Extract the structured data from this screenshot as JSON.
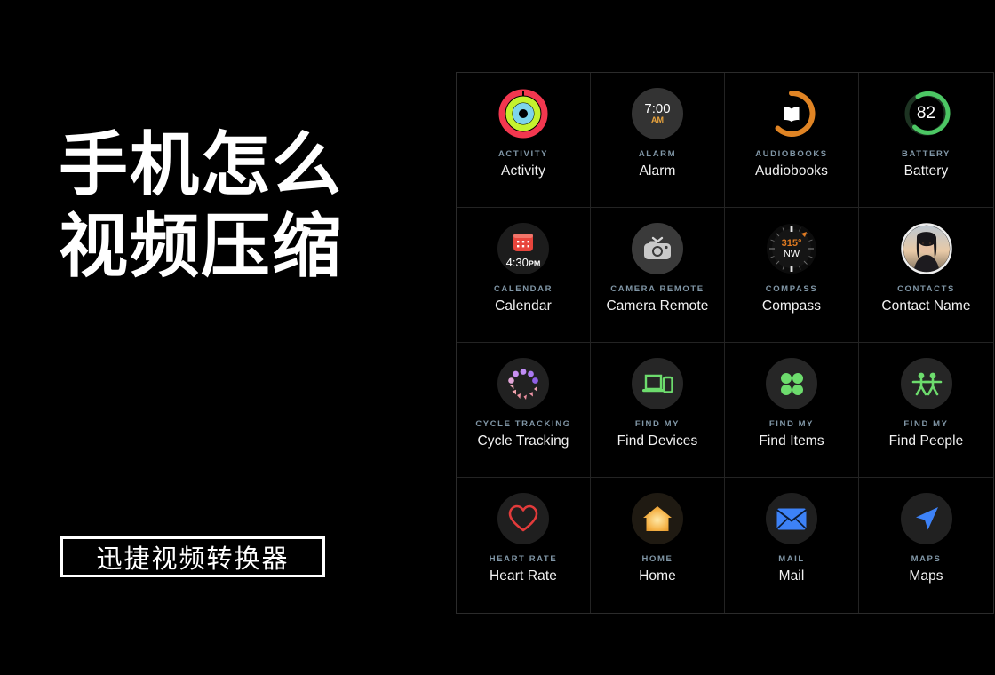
{
  "promo": {
    "title": "手机怎么\n视频压缩",
    "cta_label": "迅捷视频转换器",
    "colors": {
      "text": "#ffffff",
      "background": "#000000"
    }
  },
  "grid": {
    "columns": 4,
    "rows": 4,
    "colors": {
      "background": "#000000",
      "divider": "#232323",
      "category_label": "#8096a6",
      "app_name": "#f2f2f2"
    },
    "apps": [
      {
        "category": "ACTIVITY",
        "name": "Activity",
        "icon": "activity-rings-icon",
        "accent": "#f2374f"
      },
      {
        "category": "ALARM",
        "name": "Alarm",
        "icon": "alarm-clock-icon",
        "accent": "#e8a33d",
        "time": "7:00",
        "meridiem": "AM"
      },
      {
        "category": "AUDIOBOOKS",
        "name": "Audiobooks",
        "icon": "audiobooks-icon",
        "accent": "#e08424"
      },
      {
        "category": "BATTERY",
        "name": "Battery",
        "icon": "battery-ring-icon",
        "accent": "#4cc764",
        "value": "82"
      },
      {
        "category": "CALENDAR",
        "name": "Calendar",
        "icon": "calendar-icon",
        "accent": "#f04242",
        "time": "4:30",
        "meridiem": "PM"
      },
      {
        "category": "CAMERA REMOTE",
        "name": "Camera Remote",
        "icon": "camera-icon",
        "accent": "#b8b8b8"
      },
      {
        "category": "COMPASS",
        "name": "Compass",
        "icon": "compass-icon",
        "accent": "#e07a20",
        "heading": "315°",
        "direction": "NW"
      },
      {
        "category": "CONTACTS",
        "name": "Contact Name",
        "icon": "contact-avatar-icon",
        "accent": "#e6e6e6"
      },
      {
        "category": "CYCLE TRACKING",
        "name": "Cycle Tracking",
        "icon": "cycle-tracking-icon",
        "accent": "#9b6ef0"
      },
      {
        "category": "FIND MY",
        "name": "Find Devices",
        "icon": "find-devices-icon",
        "accent": "#6ddc6d"
      },
      {
        "category": "FIND MY",
        "name": "Find Items",
        "icon": "find-items-icon",
        "accent": "#6ddc6d"
      },
      {
        "category": "FIND MY",
        "name": "Find People",
        "icon": "find-people-icon",
        "accent": "#6ddc6d"
      },
      {
        "category": "HEART RATE",
        "name": "Heart Rate",
        "icon": "heart-icon",
        "accent": "#e23b3b"
      },
      {
        "category": "HOME",
        "name": "Home",
        "icon": "home-icon",
        "accent": "#f0a838"
      },
      {
        "category": "MAIL",
        "name": "Mail",
        "icon": "mail-envelope-icon",
        "accent": "#3d82f7"
      },
      {
        "category": "MAPS",
        "name": "Maps",
        "icon": "maps-arrow-icon",
        "accent": "#3d82f7"
      }
    ]
  }
}
